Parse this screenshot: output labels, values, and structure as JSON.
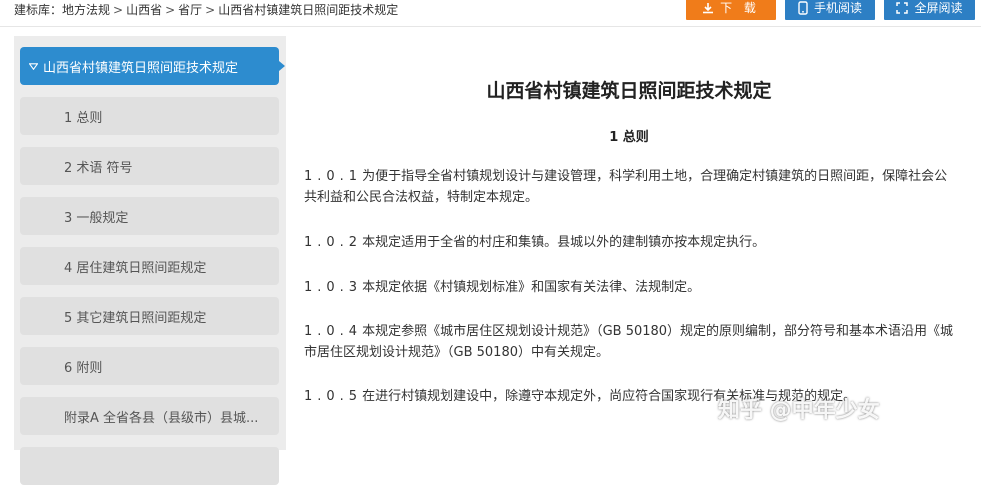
{
  "breadcrumb": {
    "items": [
      "建标库：地方法规",
      "山西省",
      "省厅",
      "山西省村镇建筑日照间距技术规定"
    ],
    "separator": ">"
  },
  "toolbar": {
    "download_label": "下 载",
    "mobile_label": "手机阅读",
    "fullscreen_label": "全屏阅读"
  },
  "sidebar": {
    "active_label": "山西省村镇建筑日照间距技术规定",
    "items": [
      "1 总则",
      "2 术语 符号",
      "3 一般规定",
      "4 居住建筑日照间距规定",
      "5 其它建筑日照间距规定",
      "6 附则",
      "附录A 全省各县（县级市）县城..."
    ]
  },
  "document": {
    "title": "山西省村镇建筑日照间距技术规定",
    "section": "1 总则",
    "paragraphs": [
      {
        "num": "1.0.1",
        "text": "为便于指导全省村镇规划设计与建设管理，科学利用土地，合理确定村镇建筑的日照间距，保障社会公共利益和公民合法权益，特制定本规定。"
      },
      {
        "num": "1.0.2",
        "text": "本规定适用于全省的村庄和集镇。县城以外的建制镇亦按本规定执行。"
      },
      {
        "num": "1.0.3",
        "text": "本规定依据《村镇规划标准》和国家有关法律、法规制定。"
      },
      {
        "num": "1.0.4",
        "text": "本规定参照《城市居住区规划设计规范》（GB 50180）规定的原则编制，部分符号和基本术语沿用《城市居住区规划设计规范》（GB 50180）中有关规定。"
      },
      {
        "num": "1.0.5",
        "text": "在进行村镇规划建设中，除遵守本规定外，尚应符合国家现行有关标准与规范的规定。"
      }
    ]
  },
  "watermark": "知乎 @中年少女",
  "colors": {
    "download": "#f07c1a",
    "action_blue": "#2d7fc4",
    "active_item": "#2d8ccf",
    "sidebar_bg": "#ececec"
  }
}
